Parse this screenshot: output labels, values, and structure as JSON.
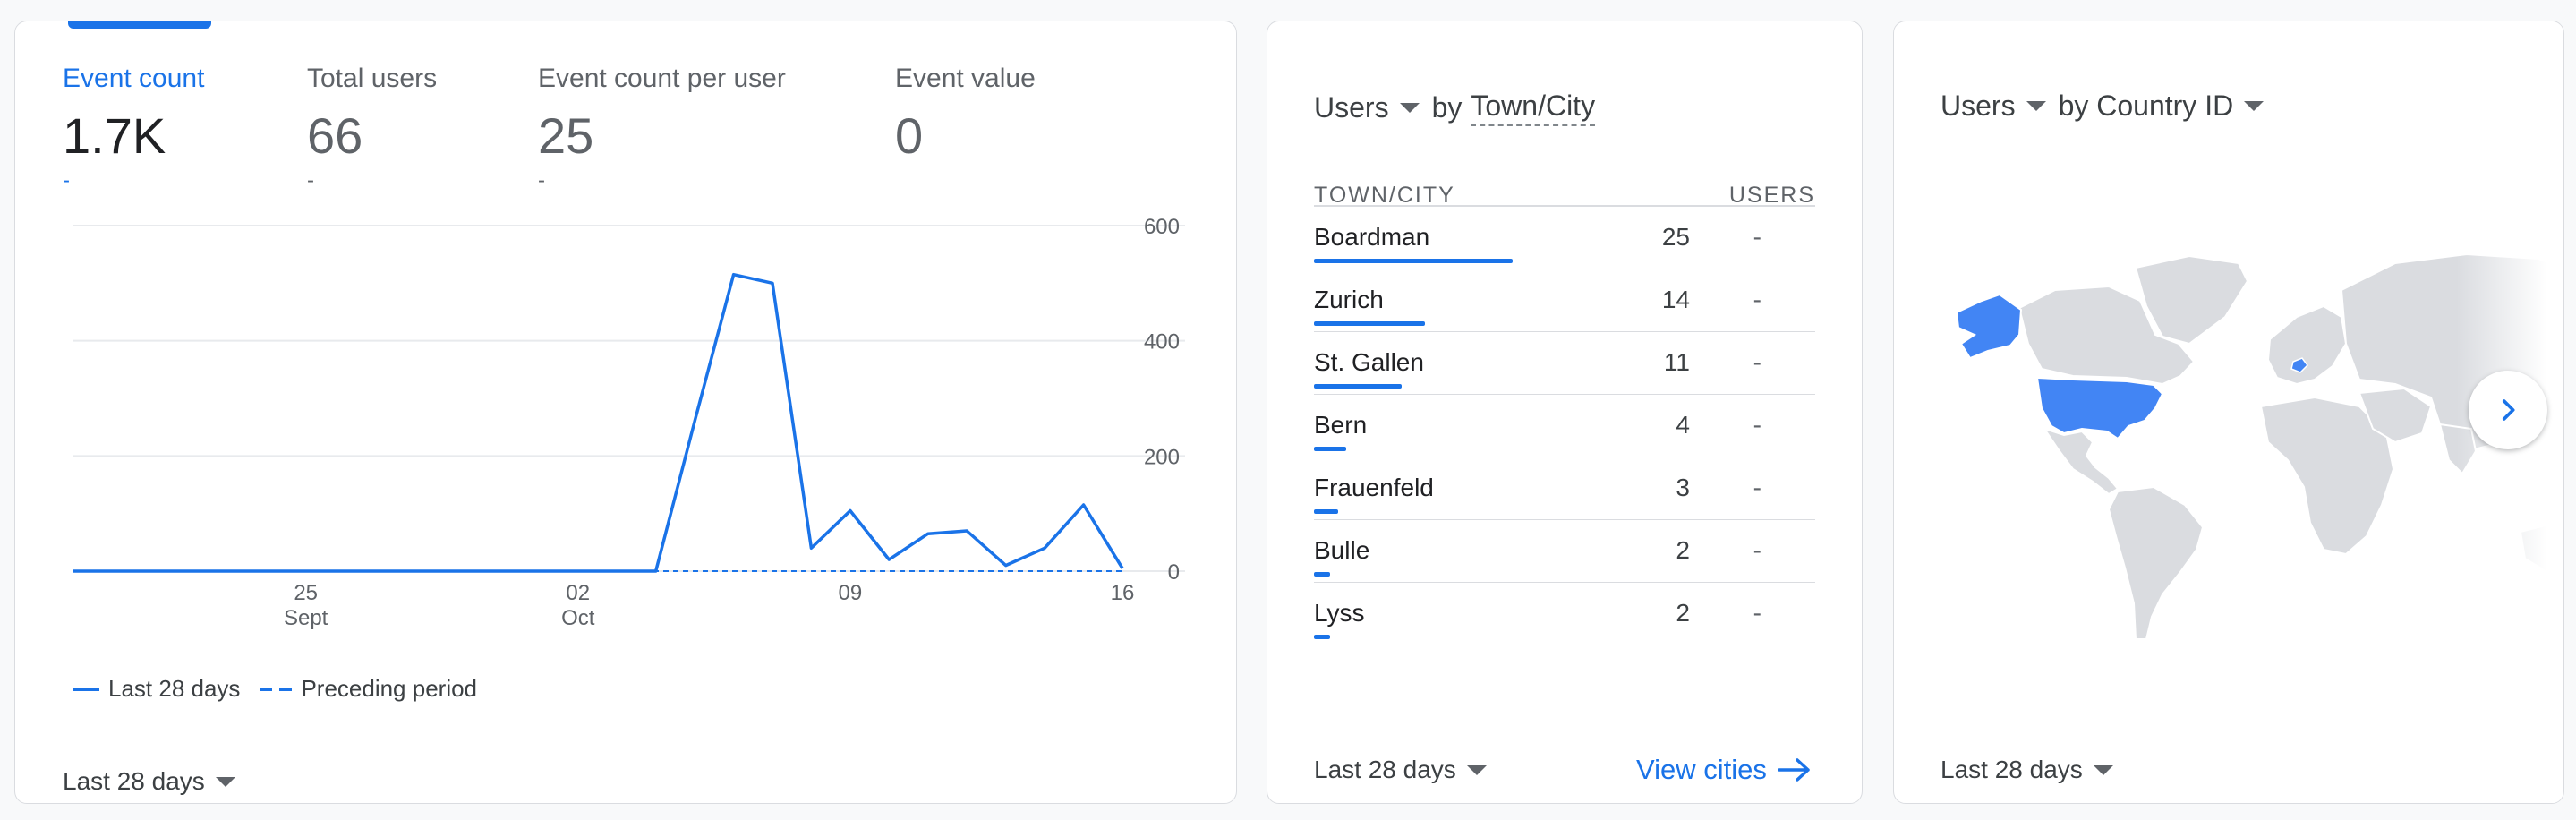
{
  "events_card": {
    "metrics": [
      {
        "label": "Event count",
        "value": "1.7K",
        "delta": "-",
        "active": true
      },
      {
        "label": "Total users",
        "value": "66",
        "delta": "-"
      },
      {
        "label": "Event count per user",
        "value": "25",
        "delta": "-"
      },
      {
        "label": "Event value",
        "value": "0",
        "delta": "-"
      }
    ],
    "legend": {
      "current": "Last 28 days",
      "previous": "Preceding period"
    },
    "date_range": "Last 28 days"
  },
  "chart_data": {
    "type": "line",
    "x": [
      "2024-09-19",
      "2024-09-20",
      "2024-09-21",
      "2024-09-22",
      "2024-09-23",
      "2024-09-24",
      "2024-09-25",
      "2024-09-26",
      "2024-09-27",
      "2024-09-28",
      "2024-09-29",
      "2024-09-30",
      "2024-10-01",
      "2024-10-02",
      "2024-10-03",
      "2024-10-04",
      "2024-10-05",
      "2024-10-06",
      "2024-10-07",
      "2024-10-08",
      "2024-10-09",
      "2024-10-10",
      "2024-10-11",
      "2024-10-12",
      "2024-10-13",
      "2024-10-14",
      "2024-10-15",
      "2024-10-16"
    ],
    "series": [
      {
        "name": "Last 28 days",
        "style": "solid",
        "values": [
          0,
          0,
          0,
          0,
          0,
          0,
          0,
          0,
          0,
          0,
          0,
          0,
          0,
          0,
          0,
          0,
          260,
          515,
          500,
          40,
          105,
          20,
          65,
          70,
          10,
          40,
          115,
          5
        ]
      },
      {
        "name": "Preceding period",
        "style": "dashed",
        "values": [
          0,
          0,
          0,
          0,
          0,
          0,
          0,
          0,
          0,
          0,
          0,
          0,
          0,
          0,
          0,
          0,
          0,
          0,
          0,
          0,
          0,
          0,
          0,
          0,
          0,
          0,
          0,
          0
        ]
      }
    ],
    "x_ticks": [
      {
        "day": "25",
        "month": "Sept",
        "index": 6
      },
      {
        "day": "02",
        "month": "Oct",
        "index": 13
      },
      {
        "day": "09",
        "month": "",
        "index": 20
      },
      {
        "day": "16",
        "month": "",
        "index": 27
      }
    ],
    "y_ticks": [
      0,
      200,
      400,
      600
    ],
    "ylim": [
      0,
      600
    ],
    "y_axis_side": "right",
    "grid": true,
    "color": "#1a73e8"
  },
  "cities_card": {
    "metric_label": "Users",
    "by_label": "by",
    "dimension_label": "Town/City",
    "col_city": "TOWN/CITY",
    "col_users": "USERS",
    "rows": [
      {
        "city": "Boardman",
        "users": "25",
        "delta": "-"
      },
      {
        "city": "Zurich",
        "users": "14",
        "delta": "-"
      },
      {
        "city": "St. Gallen",
        "users": "11",
        "delta": "-"
      },
      {
        "city": "Bern",
        "users": "4",
        "delta": "-"
      },
      {
        "city": "Frauenfeld",
        "users": "3",
        "delta": "-"
      },
      {
        "city": "Bulle",
        "users": "2",
        "delta": "-"
      },
      {
        "city": "Lyss",
        "users": "2",
        "delta": "-"
      }
    ],
    "max_users": 25,
    "date_range": "Last 28 days",
    "view_link": "View cities"
  },
  "countries_card": {
    "metric_label": "Users",
    "dimension_label": "by Country ID",
    "date_range": "Last 28 days",
    "highlighted_countries": [
      "United States",
      "Switzerland"
    ],
    "highlight_color": "#4285f4",
    "base_color": "#dadce0"
  },
  "icons": {
    "caret": "caret-down-icon",
    "arrow": "arrow-right-icon",
    "next": "chevron-right-icon"
  }
}
